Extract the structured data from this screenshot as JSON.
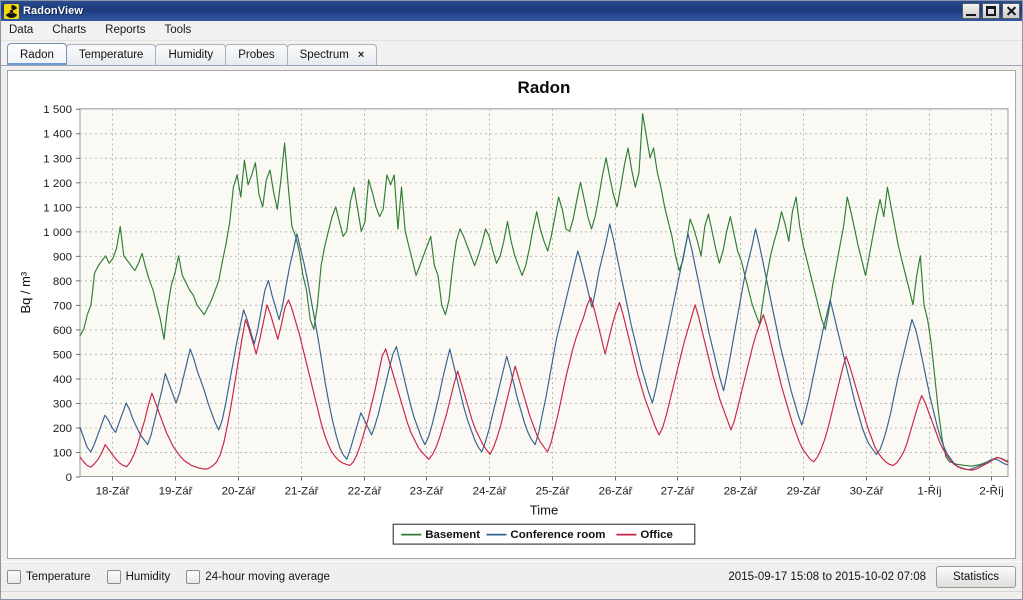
{
  "window": {
    "title": "RadonView",
    "icon": "radiation-trefoil-icon",
    "minimize_label": "Minimize",
    "maximize_label": "Maximize",
    "close_label": "Close"
  },
  "menubar": {
    "items": [
      {
        "label": "Data"
      },
      {
        "label": "Charts"
      },
      {
        "label": "Reports"
      },
      {
        "label": "Tools"
      }
    ]
  },
  "tabs": [
    {
      "label": "Radon",
      "active": true,
      "closable": false
    },
    {
      "label": "Temperature",
      "active": false,
      "closable": false
    },
    {
      "label": "Humidity",
      "active": false,
      "closable": false
    },
    {
      "label": "Probes",
      "active": false,
      "closable": false
    },
    {
      "label": "Spectrum",
      "active": false,
      "closable": true,
      "close_glyph": "×"
    }
  ],
  "bottombar": {
    "checkboxes": [
      {
        "label": "Temperature",
        "checked": false
      },
      {
        "label": "Humidity",
        "checked": false
      },
      {
        "label": "24-hour moving average",
        "checked": false
      }
    ],
    "date_range": "2015-09-17 15:08 to 2015-10-02 07:08",
    "statistics_label": "Statistics"
  },
  "chart_data": {
    "type": "line",
    "title": "Radon",
    "xlabel": "Time",
    "ylabel": "Bq / m³",
    "ylim": [
      0,
      1500
    ],
    "ytick_step": 100,
    "yticks": [
      "0",
      "100",
      "200",
      "300",
      "400",
      "500",
      "600",
      "700",
      "800",
      "900",
      "1 000",
      "1 100",
      "1 200",
      "1 300",
      "1 400",
      "1 500"
    ],
    "xticks": [
      "18-Zář",
      "19-Zář",
      "20-Zář",
      "21-Zář",
      "22-Zář",
      "23-Zář",
      "24-Zář",
      "25-Zář",
      "26-Zář",
      "27-Zář",
      "28-Zář",
      "29-Zář",
      "30-Zář",
      "1-Říj",
      "2-Říj"
    ],
    "x_start": "2015-09-17 15:08",
    "x_end": "2015-10-02 07:08",
    "grid": true,
    "legend_position": "bottom",
    "plot_bg": "#faf9f4",
    "grid_color": "#b9b9b9",
    "series": [
      {
        "name": "Basement",
        "color": "#2f7d32",
        "values": [
          575,
          600,
          660,
          700,
          830,
          860,
          880,
          900,
          870,
          890,
          930,
          1020,
          900,
          880,
          860,
          840,
          870,
          910,
          850,
          800,
          760,
          700,
          640,
          560,
          690,
          780,
          830,
          900,
          820,
          790,
          760,
          740,
          700,
          680,
          660,
          690,
          720,
          760,
          800,
          880,
          950,
          1040,
          1180,
          1230,
          1140,
          1290,
          1190,
          1230,
          1280,
          1150,
          1100,
          1210,
          1250,
          1160,
          1090,
          1210,
          1360,
          1180,
          1020,
          980,
          920,
          820,
          760,
          640,
          600,
          700,
          860,
          940,
          1000,
          1060,
          1100,
          1040,
          980,
          1000,
          1120,
          1180,
          1090,
          1000,
          1040,
          1210,
          1160,
          1100,
          1060,
          1090,
          1230,
          1190,
          1230,
          1010,
          1180,
          1000,
          940,
          880,
          820,
          860,
          900,
          940,
          980,
          860,
          820,
          700,
          660,
          720,
          860,
          960,
          1010,
          980,
          940,
          900,
          860,
          900,
          950,
          1010,
          980,
          920,
          870,
          900,
          960,
          1040,
          960,
          900,
          860,
          820,
          860,
          930,
          1010,
          1080,
          1010,
          960,
          920,
          980,
          1060,
          1140,
          1090,
          1010,
          1000,
          1050,
          1130,
          1200,
          1130,
          1060,
          1010,
          1060,
          1140,
          1230,
          1300,
          1220,
          1150,
          1100,
          1180,
          1270,
          1340,
          1250,
          1180,
          1240,
          1480,
          1390,
          1300,
          1340,
          1240,
          1180,
          1100,
          1040,
          980,
          900,
          840,
          880,
          960,
          1050,
          1010,
          960,
          900,
          1020,
          1070,
          1000,
          930,
          870,
          920,
          1000,
          1060,
          990,
          920,
          880,
          820,
          760,
          700,
          660,
          620,
          720,
          820,
          900,
          960,
          1010,
          1080,
          1030,
          960,
          1080,
          1140,
          1020,
          940,
          880,
          820,
          760,
          700,
          640,
          600,
          680,
          780,
          860,
          940,
          1020,
          1140,
          1080,
          1010,
          940,
          880,
          820,
          900,
          980,
          1060,
          1130,
          1060,
          1180,
          1100,
          1020,
          940,
          880,
          820,
          760,
          700,
          820,
          900,
          700,
          640,
          540,
          400,
          260,
          150,
          80,
          60,
          55,
          50,
          48,
          46,
          44,
          42,
          45,
          48,
          52,
          58,
          64,
          70,
          78,
          74,
          68,
          62
        ]
      },
      {
        "name": "Conference room",
        "color": "#36618e",
        "values": [
          200,
          160,
          120,
          100,
          130,
          170,
          210,
          250,
          230,
          200,
          180,
          220,
          260,
          300,
          270,
          230,
          200,
          170,
          150,
          130,
          170,
          230,
          290,
          350,
          420,
          380,
          340,
          300,
          340,
          400,
          460,
          520,
          480,
          430,
          390,
          350,
          300,
          260,
          220,
          190,
          230,
          300,
          380,
          460,
          540,
          610,
          680,
          640,
          590,
          540,
          600,
          680,
          760,
          800,
          740,
          690,
          640,
          700,
          780,
          860,
          920,
          990,
          930,
          870,
          800,
          720,
          640,
          560,
          470,
          380,
          300,
          230,
          170,
          120,
          90,
          70,
          110,
          160,
          210,
          260,
          230,
          200,
          170,
          210,
          260,
          320,
          380,
          440,
          500,
          530,
          470,
          410,
          350,
          290,
          240,
          200,
          160,
          130,
          160,
          210,
          270,
          330,
          400,
          460,
          520,
          460,
          400,
          340,
          280,
          230,
          190,
          150,
          120,
          100,
          140,
          190,
          250,
          310,
          370,
          430,
          490,
          440,
          380,
          320,
          270,
          220,
          180,
          150,
          130,
          180,
          250,
          320,
          400,
          480,
          560,
          620,
          680,
          740,
          800,
          860,
          920,
          870,
          810,
          750,
          690,
          760,
          840,
          900,
          960,
          1030,
          970,
          900,
          830,
          760,
          690,
          620,
          560,
          500,
          440,
          390,
          340,
          300,
          360,
          430,
          500,
          570,
          640,
          710,
          780,
          850,
          920,
          990,
          930,
          860,
          790,
          720,
          650,
          580,
          520,
          460,
          400,
          350,
          420,
          500,
          580,
          660,
          740,
          820,
          880,
          940,
          1010,
          950,
          880,
          810,
          740,
          670,
          600,
          530,
          470,
          410,
          350,
          300,
          250,
          210,
          260,
          320,
          390,
          460,
          530,
          600,
          660,
          720,
          660,
          600,
          540,
          480,
          420,
          360,
          300,
          250,
          200,
          160,
          130,
          110,
          90,
          110,
          150,
          200,
          260,
          330,
          400,
          460,
          520,
          580,
          640,
          600,
          540,
          470,
          400,
          330,
          270,
          210,
          160,
          120,
          90,
          70,
          50,
          40,
          35,
          30,
          28,
          32,
          38,
          44,
          50,
          58,
          66,
          72,
          68,
          60,
          52,
          48
        ]
      },
      {
        "name": "Office",
        "color": "#c8224a",
        "values": [
          80,
          60,
          45,
          38,
          52,
          70,
          95,
          130,
          110,
          90,
          70,
          55,
          45,
          40,
          60,
          90,
          130,
          180,
          230,
          290,
          340,
          300,
          260,
          220,
          180,
          150,
          120,
          100,
          80,
          65,
          55,
          45,
          40,
          35,
          32,
          30,
          35,
          45,
          60,
          90,
          140,
          210,
          290,
          380,
          470,
          560,
          640,
          600,
          550,
          500,
          560,
          630,
          700,
          660,
          610,
          560,
          620,
          690,
          720,
          680,
          630,
          580,
          520,
          460,
          400,
          340,
          280,
          220,
          170,
          130,
          100,
          80,
          65,
          55,
          50,
          45,
          60,
          90,
          130,
          180,
          230,
          290,
          350,
          420,
          490,
          520,
          470,
          420,
          370,
          320,
          270,
          220,
          180,
          150,
          120,
          100,
          85,
          70,
          90,
          120,
          160,
          210,
          260,
          320,
          380,
          430,
          380,
          330,
          280,
          230,
          190,
          160,
          130,
          110,
          90,
          120,
          160,
          210,
          270,
          330,
          390,
          450,
          400,
          350,
          300,
          250,
          210,
          170,
          140,
          120,
          100,
          140,
          200,
          260,
          330,
          400,
          460,
          520,
          570,
          610,
          650,
          700,
          730,
          680,
          620,
          560,
          500,
          560,
          620,
          670,
          710,
          660,
          600,
          540,
          480,
          420,
          370,
          320,
          280,
          240,
          200,
          170,
          200,
          250,
          310,
          370,
          430,
          490,
          550,
          600,
          650,
          700,
          650,
          590,
          530,
          470,
          410,
          360,
          310,
          270,
          230,
          190,
          230,
          290,
          350,
          410,
          470,
          530,
          580,
          620,
          660,
          610,
          550,
          490,
          430,
          370,
          320,
          270,
          220,
          180,
          140,
          110,
          90,
          70,
          60,
          80,
          110,
          150,
          200,
          260,
          320,
          380,
          440,
          490,
          450,
          400,
          350,
          300,
          250,
          200,
          160,
          120,
          95,
          75,
          60,
          50,
          45,
          55,
          75,
          100,
          140,
          190,
          240,
          290,
          330,
          300,
          260,
          220,
          180,
          140,
          110,
          85,
          65,
          50,
          40,
          34,
          30,
          28,
          26,
          30,
          36,
          44,
          52,
          60,
          70,
          78,
          74,
          66,
          58
        ]
      }
    ]
  }
}
